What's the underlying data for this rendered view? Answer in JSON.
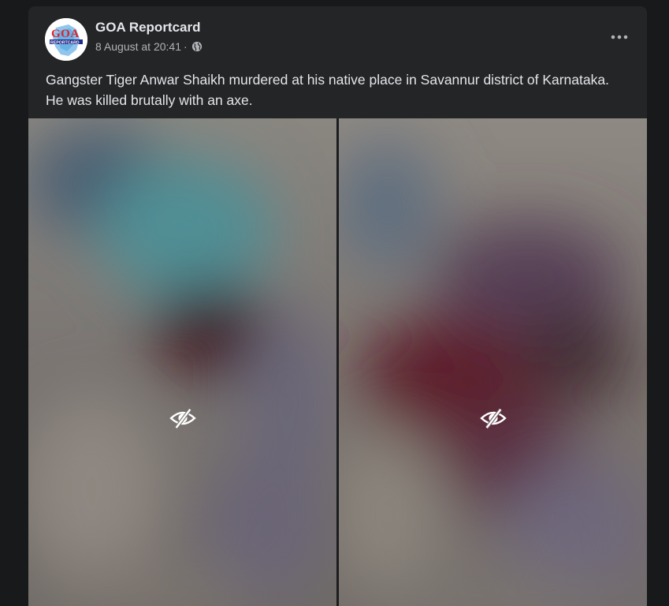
{
  "post": {
    "author": "GOA Reportcard",
    "timestamp": "8 August at 20:41",
    "separator": "·",
    "privacy_icon": "globe-icon",
    "more_icon": "more-options-icon",
    "caption": "Gangster Tiger Anwar Shaikh murdered at his native place in Savannur district of Karnataka. He was killed brutally with an axe.",
    "avatar_logo": {
      "text_top": "GOA",
      "text_band": "REPORTCARD"
    },
    "photos": [
      {
        "state": "hidden-sensitive",
        "overlay_icon": "eye-slash-icon"
      },
      {
        "state": "hidden-sensitive",
        "overlay_icon": "eye-slash-icon"
      }
    ]
  },
  "colors": {
    "page_bg": "#18191a",
    "card_bg": "#242526",
    "primary_text": "#e4e6eb",
    "secondary_text": "#b0b3b8"
  }
}
